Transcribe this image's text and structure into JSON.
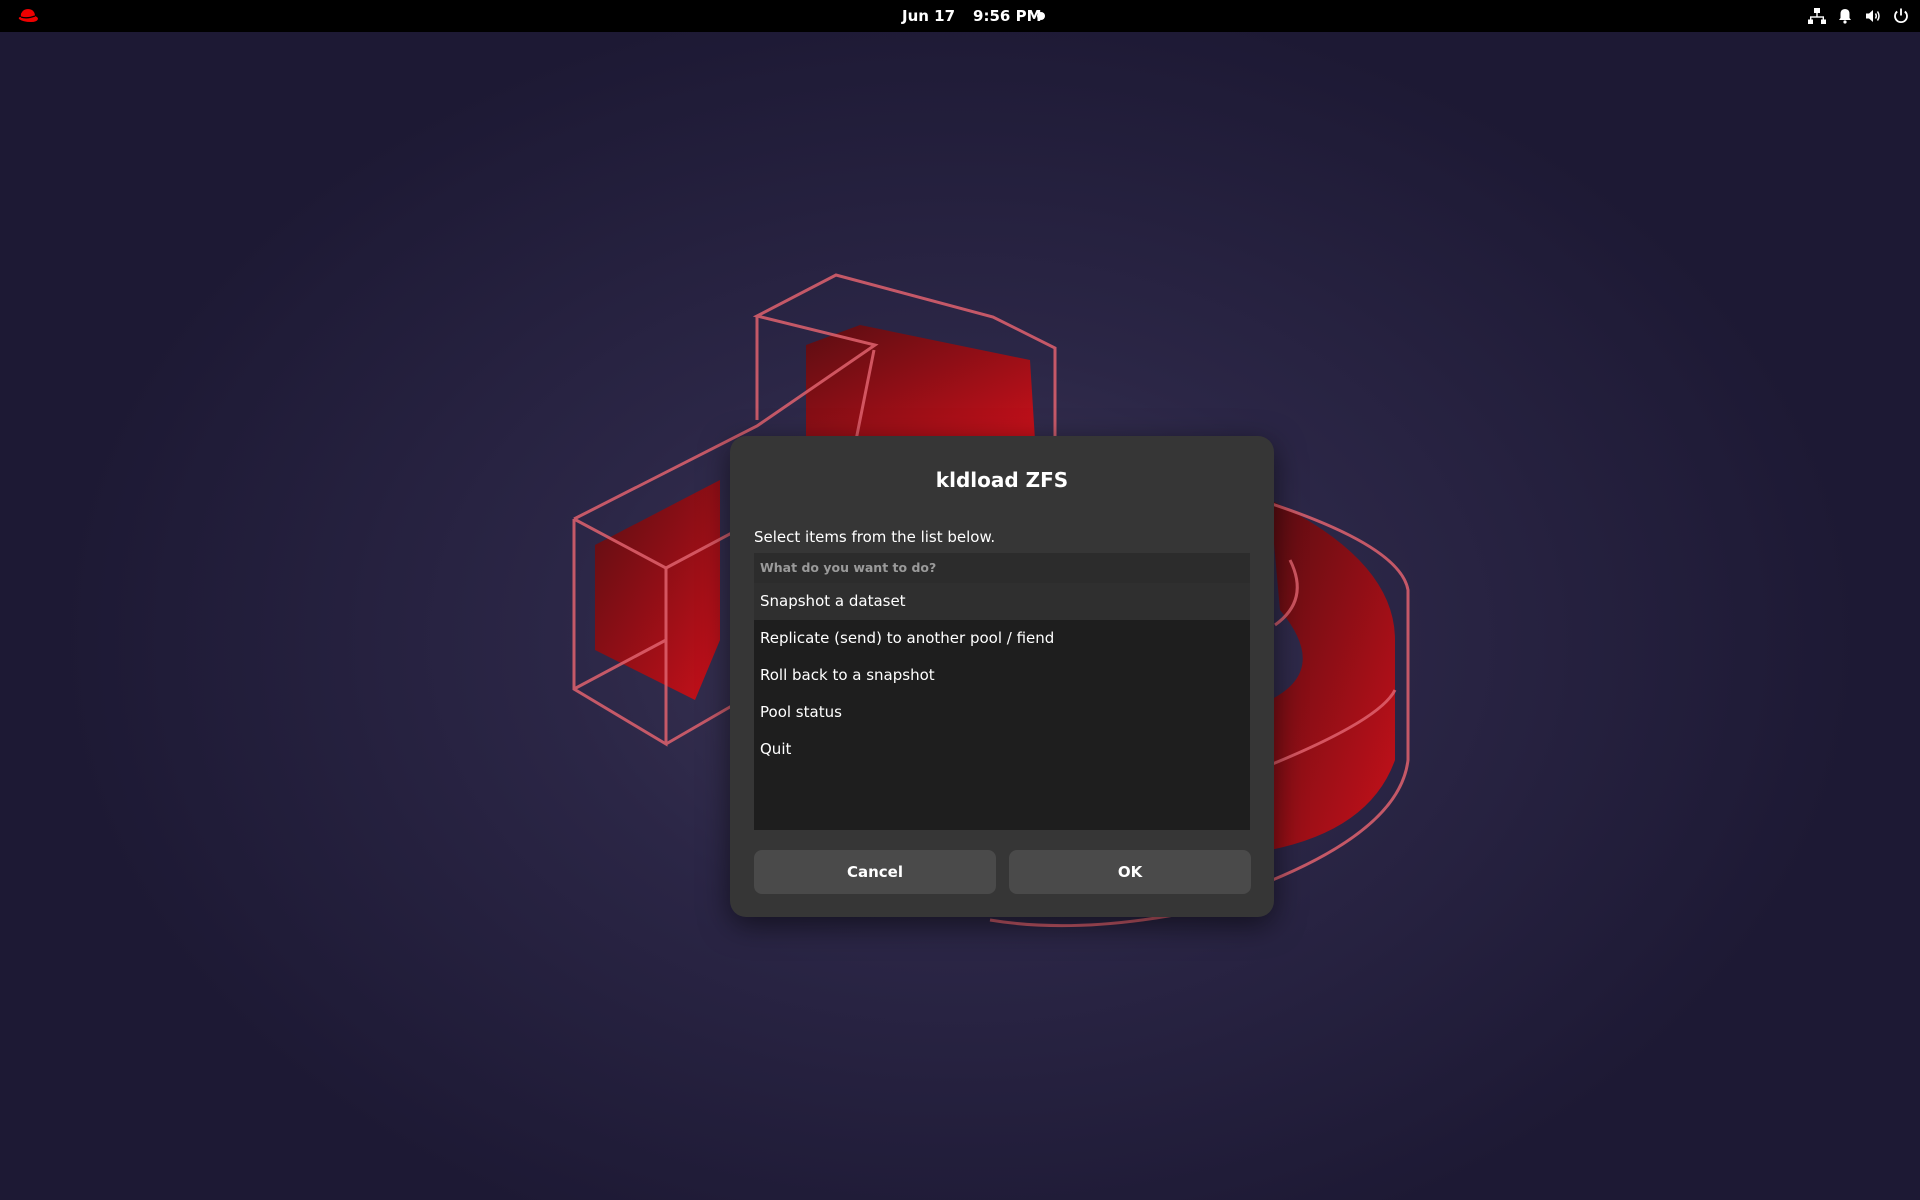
{
  "topbar": {
    "date": "Jun 17",
    "time": "9:56 PM",
    "icons": [
      "redhat-logo-icon",
      "network-icon",
      "notification-bell-icon",
      "volume-icon",
      "power-icon"
    ]
  },
  "dialog": {
    "title": "kldload ZFS",
    "prompt": "Select items from the list below.",
    "list_header": "What do you want to do?",
    "items": [
      "Snapshot a dataset",
      "Replicate (send) to another pool / fiend",
      "Roll back to a snapshot",
      "Pool status",
      "Quit"
    ],
    "selected_index": 0,
    "cancel_label": "Cancel",
    "ok_label": "OK"
  },
  "colors": {
    "accent": "#cc0000",
    "dialog_bg": "#363636",
    "list_bg": "#1e1e1e",
    "button_bg": "#4a4a4a"
  }
}
